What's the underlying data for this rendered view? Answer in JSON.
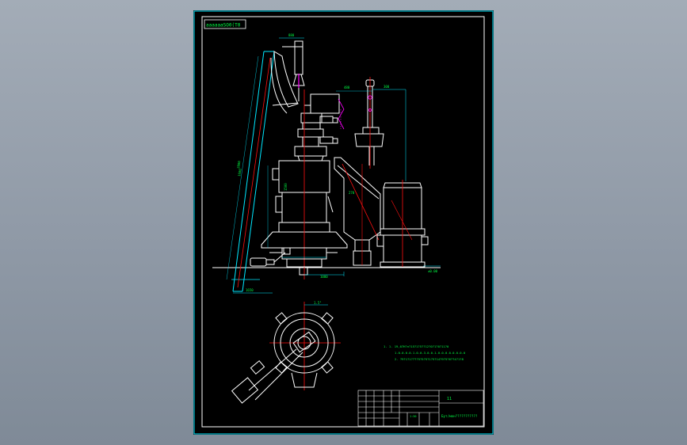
{
  "drawing": {
    "label_box_text": "ааааааSO0(Т0",
    "dims": {
      "top_width": "880",
      "hopper_width": "480",
      "pipe_offset": "300",
      "inclined_length": "2800",
      "hoist_height": "1600",
      "base_length": "1650",
      "mill_height": "1500",
      "body_width": "270",
      "base_right": "1000",
      "floor_mark": "±0.00",
      "plan_top": "1.5°"
    },
    "notes": [
      "1. 1. 19,07Н?н?15?1?5??12?0?1?0?11?0",
      "1.0.0.0.0.1.0.0.3.0.0.1.0.0.0.0.0.0.0.0",
      "2. ?9?1?1?7??5?5?5?1?5?14?9?5?6??4?1?8"
    ],
    "title_block": {
      "drawing_number": "11",
      "title": "Бут/мон???????????",
      "sign_text": "1:30"
    }
  },
  "colors": {
    "background": "#8f99a6",
    "sheet": "#000000",
    "border": "#ffffff",
    "cyan": "#00e8ff",
    "red": "#ff1010",
    "magenta": "#ff00ff",
    "green": "#00ff44",
    "yellow": "#ffff00"
  }
}
